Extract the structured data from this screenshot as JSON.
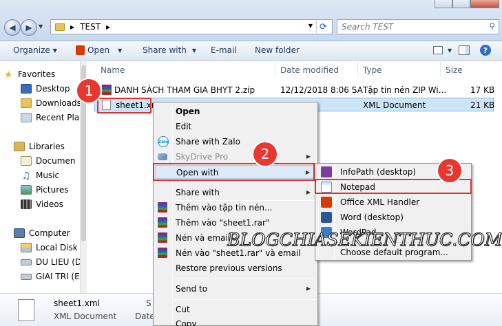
{
  "address": {
    "path_label": "TEST",
    "search_placeholder": "Search TEST"
  },
  "toolbar": {
    "organize": "Organize",
    "open": "Open",
    "share_with": "Share with",
    "email": "E-mail",
    "new_folder": "New folder"
  },
  "nav": {
    "favorites": "Favorites",
    "desktop": "Desktop",
    "downloads": "Downloads",
    "recent": "Recent Plac",
    "libraries": "Libraries",
    "documents": "Documen",
    "music": "Music",
    "pictures": "Pictures",
    "videos": "Videos",
    "computer": "Computer",
    "local_disk": "Local Disk",
    "du_lieu": "DU LIEU (D",
    "giai_tri": "GIAI TRI (E:"
  },
  "columns": {
    "name": "Name",
    "date": "Date modified",
    "type": "Type",
    "size": "Size"
  },
  "files": [
    {
      "name": "DANH SÁCH THAM GIA BHYT 2.zip",
      "date": "12/12/2018 8:06 SA",
      "type": "Tập tin nén ZIP Wi...",
      "size": "17 KB"
    },
    {
      "name": "sheet1.xm",
      "date": "",
      "type": "XML Document",
      "size": "21 KB"
    }
  ],
  "context_menu": {
    "open": "Open",
    "edit": "Edit",
    "share_zalo": "Share with Zalo",
    "skydrive": "SkyDrive Pro",
    "open_with": "Open with",
    "share_with": "Share with",
    "add_archive": "Thêm vào tập tin nén...",
    "add_rar": "Thêm vào \"sheet1.rar\"",
    "compress_email": "Nén và email...",
    "compress_rar_email": "Nén vào \"sheet1.rar\" và email",
    "restore": "Restore previous versions",
    "send_to": "Send to",
    "cut": "Cut",
    "copy": "Copy"
  },
  "submenu": {
    "infopath": "InfoPath (desktop)",
    "notepad": "Notepad",
    "office_xml": "Office XML Handler",
    "word": "Word (desktop)",
    "wordpad": "WordPad",
    "choose": "Choose default program..."
  },
  "details": {
    "filename": "sheet1.xml",
    "filetype": "XML Document",
    "col2a": "S",
    "col2b": "Date creat"
  },
  "badges": {
    "b1": "1",
    "b2": "2",
    "b3": "3"
  },
  "zalo_label": "Zalo",
  "watermark": "BLOGCHIASEKIENTHUC.COM",
  "colors": {
    "highlight": "#e0312f",
    "selection": "#cde6f7"
  }
}
